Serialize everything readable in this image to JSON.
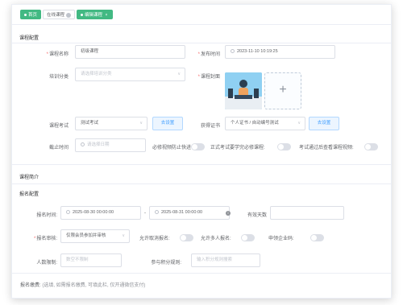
{
  "tabs": [
    {
      "label": "首页",
      "active": true
    },
    {
      "label": "在线课程",
      "active": false
    },
    {
      "label": "编辑课程",
      "active": true
    }
  ],
  "sections": {
    "course_config": "课程配置",
    "course_intro": "课程简介",
    "signup_config": "报名配置"
  },
  "form": {
    "course_name": {
      "label": "课程名称",
      "value": "初级课程"
    },
    "publish_time": {
      "label": "发布时间",
      "value": "2023-11-10 10:19:25"
    },
    "training_category": {
      "label": "培训分类",
      "placeholder": "请选择培训分类"
    },
    "course_cover": {
      "label": "课程封面",
      "upload_icon": "+"
    },
    "course_exam": {
      "label": "课程考试",
      "value": "测试考试",
      "button": "去设置"
    },
    "certificate": {
      "label": "获得证书",
      "value": "个人证书 / 自动编号测试",
      "button": "去设置"
    },
    "deadline": {
      "label": "截止时间",
      "placeholder": "请选择日期"
    },
    "must_watch_video": {
      "label": "必修视频防止快进",
      "on": false
    },
    "formal_exam_requirement": {
      "label": "正式考试要学完必修课程:",
      "on": false
    },
    "pass_exam_view_video": {
      "label": "考试通过后查看课程视频:",
      "on": false
    },
    "signup_time": {
      "label": "报名时间:",
      "start": "2025-08-30 00:00:00",
      "separator": "-",
      "end": "2025-08-31 00:00:00",
      "info": "i"
    },
    "valid_days": {
      "label": "有效天数",
      "value": ""
    },
    "signup_review": {
      "label": "报名审核:",
      "value": "仅限会员参加并审核"
    },
    "allow_cancel": {
      "label": "允许取消报名:",
      "on": false
    },
    "allow_multi": {
      "label": "允许多人报名:",
      "on": false
    },
    "enterprise_application": {
      "label": "申领企业码:",
      "on": false
    },
    "headcount_limit": {
      "label": "人数限制:",
      "placeholder": "数空不限制"
    },
    "points_rule": {
      "label": "参与积分规则:",
      "placeholder": "输入积分规则搜索"
    },
    "signup_fee": {
      "label": "报名缴费:",
      "hint": "(选填, 如需报名缴费, 可填此栏, 仅开通微信支付)"
    }
  },
  "colors": {
    "accent": "#42b983",
    "required": "#f56c6c",
    "button": "#409eff"
  }
}
